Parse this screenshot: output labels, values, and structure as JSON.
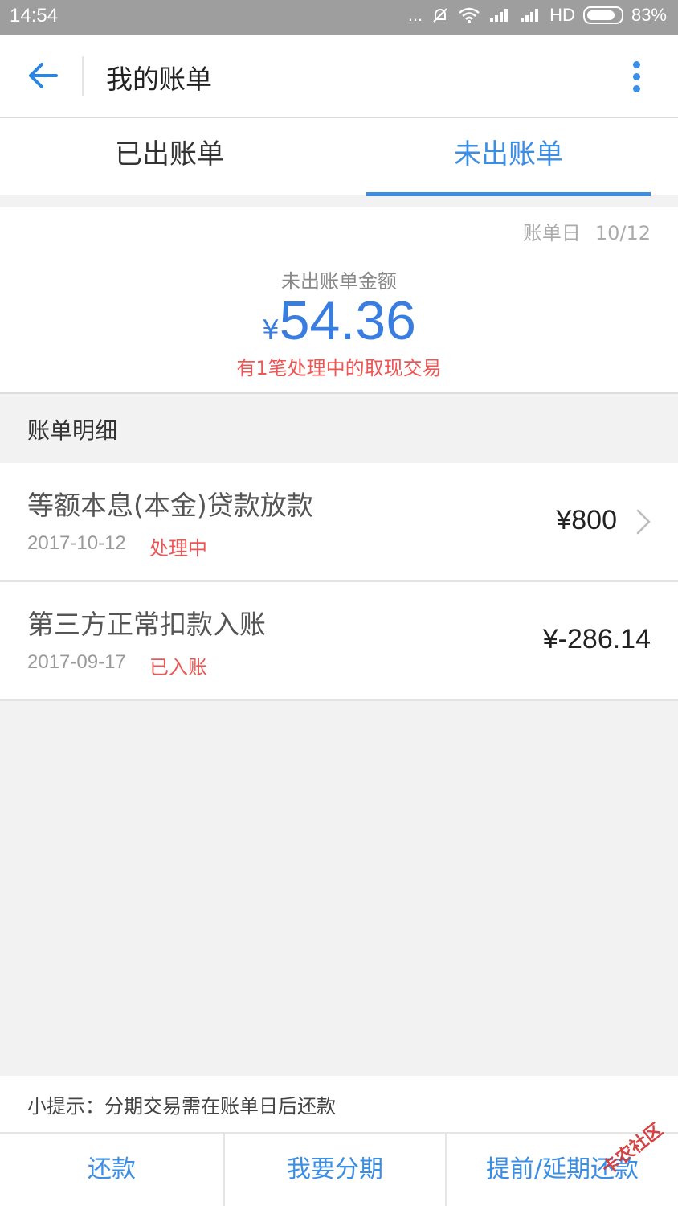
{
  "status_bar": {
    "time": "14:54",
    "dots": "...",
    "network": "HD",
    "battery": "83%"
  },
  "header": {
    "title": "我的账单"
  },
  "tabs": [
    {
      "label": "已出账单",
      "active": false
    },
    {
      "label": "未出账单",
      "active": true
    }
  ],
  "summary": {
    "bill_day_label": "账单日",
    "bill_day_value": "10/12",
    "amount_label": "未出账单金额",
    "currency": "¥",
    "amount": "54.36",
    "note": "有1笔处理中的取现交易"
  },
  "details": {
    "header": "账单明细",
    "items": [
      {
        "title": "等额本息(本金)贷款放款",
        "date": "2017-10-12",
        "status": "处理中",
        "amount": "¥800"
      },
      {
        "title": "第三方正常扣款入账",
        "date": "2017-09-17",
        "status": "已入账",
        "amount": "¥-286.14"
      }
    ]
  },
  "tip": "小提示：分期交易需在账单日后还款",
  "actions": [
    {
      "label": "还款"
    },
    {
      "label": "我要分期"
    },
    {
      "label": "提前/延期还款"
    }
  ],
  "watermark": "卡农社区",
  "colors": {
    "accent": "#3a8ee6",
    "amount": "#3a7de0",
    "alert": "#ee5555",
    "status_bar": "#9e9e9e"
  }
}
